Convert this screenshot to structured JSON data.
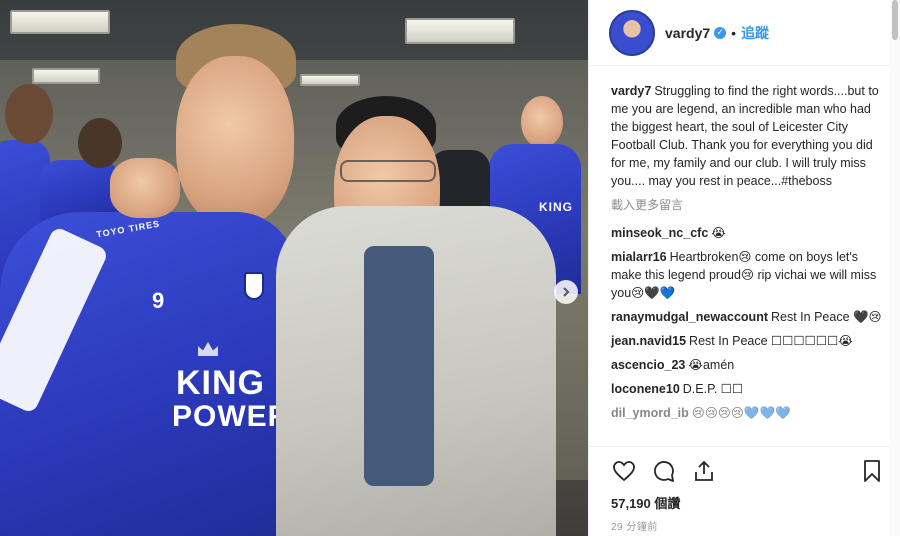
{
  "post": {
    "username": "vardy7",
    "follow_label": "追蹤",
    "separator": "•",
    "caption": "Struggling to find the right words....but to me you are legend, an incredible man who had the biggest heart, the soul of Leicester City Football Club. Thank you for everything you did for me, my family and our club. I will truly miss you.... may you rest in peace...#theboss",
    "load_more": "載入更多留言",
    "comments": [
      {
        "user": "minseok_nc_cfc",
        "text": "😭"
      },
      {
        "user": "mialarr16",
        "text": "Heartbroken😢 come on boys let's make this legend proud😢 rip vichai we will miss you😢🖤💙"
      },
      {
        "user": "ranaymudgal_newaccount",
        "text": "Rest In Peace 🖤😢"
      },
      {
        "user": "jean.navid15",
        "text": "Rest In Peace ☐☐☐☐☐☐😭"
      },
      {
        "user": "ascencio_23",
        "text": "😭amén"
      },
      {
        "user": "loconene10",
        "text": "D.E.P. ☐☐"
      },
      {
        "user": "dil_ymord_ib",
        "text": "😢😢😢😢💙💙💙"
      }
    ],
    "likes": "57,190 個讚",
    "timestamp": "29 分鐘前"
  },
  "photo": {
    "jersey_number": "9",
    "sponsor_line1": "KING",
    "sponsor_line2": "POWER",
    "sleeve_text": "TOYO TIRES",
    "bg_sponsor": "KING"
  },
  "icons": {
    "heart": "heart-icon",
    "comment": "comment-icon",
    "share": "share-icon",
    "bookmark": "bookmark-icon",
    "next": "chevron-right-icon",
    "verified": "verified-badge-icon"
  },
  "colors": {
    "accent": "#3897f0",
    "jersey": "#3c4fd8"
  }
}
